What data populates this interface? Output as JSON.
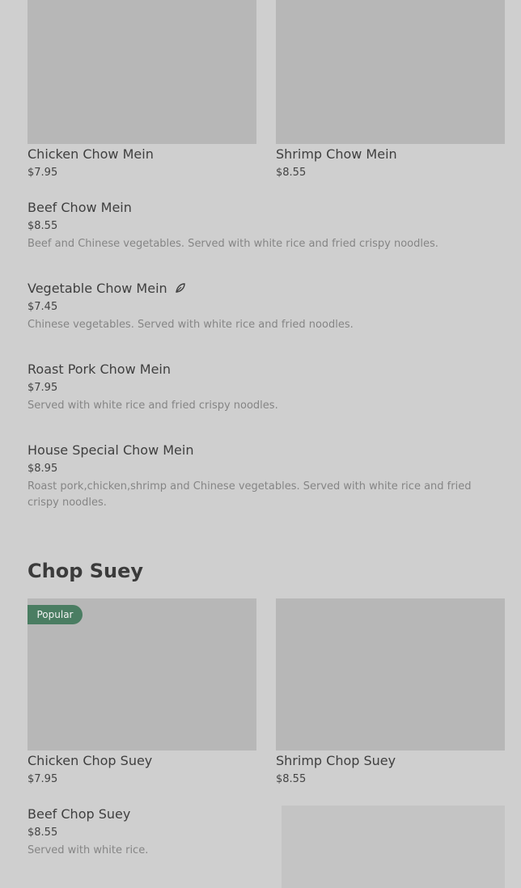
{
  "top_cards": [
    {
      "title": "Chicken Chow Mein",
      "price": "$7.95"
    },
    {
      "title": "Shrimp Chow Mein",
      "price": "$8.55"
    }
  ],
  "chow_mein_items": [
    {
      "title": "Beef Chow Mein",
      "price": "$8.55",
      "description": "Beef and Chinese vegetables. Served with white rice and fried crispy noodles."
    },
    {
      "title": "Vegetable Chow Mein",
      "price": "$7.45",
      "description": "Chinese vegetables. Served with white rice and fried noodles.",
      "icon": "leaf-icon"
    },
    {
      "title": "Roast Pork Chow Mein",
      "price": "$7.95",
      "description": "Served with white rice and fried crispy noodles."
    },
    {
      "title": "House Special Chow Mein",
      "price": "$8.95",
      "description": "Roast pork,chicken,shrimp and Chinese vegetables. Served with white rice and fried crispy noodles."
    }
  ],
  "chop_suey": {
    "heading": "Chop Suey",
    "badge": "Popular",
    "cards": [
      {
        "title": "Chicken Chop Suey",
        "price": "$7.95"
      },
      {
        "title": "Shrimp Chop Suey",
        "price": "$8.55"
      }
    ],
    "items": [
      {
        "title": "Beef Chop Suey",
        "price": "$8.55",
        "description": "Served with white rice."
      }
    ]
  },
  "colors": {
    "background": "#cfcfcf",
    "image_placeholder": "#b7b7b7",
    "badge": "#4a7d62",
    "text_primary": "#3f3f3f",
    "text_secondary": "#858585"
  }
}
